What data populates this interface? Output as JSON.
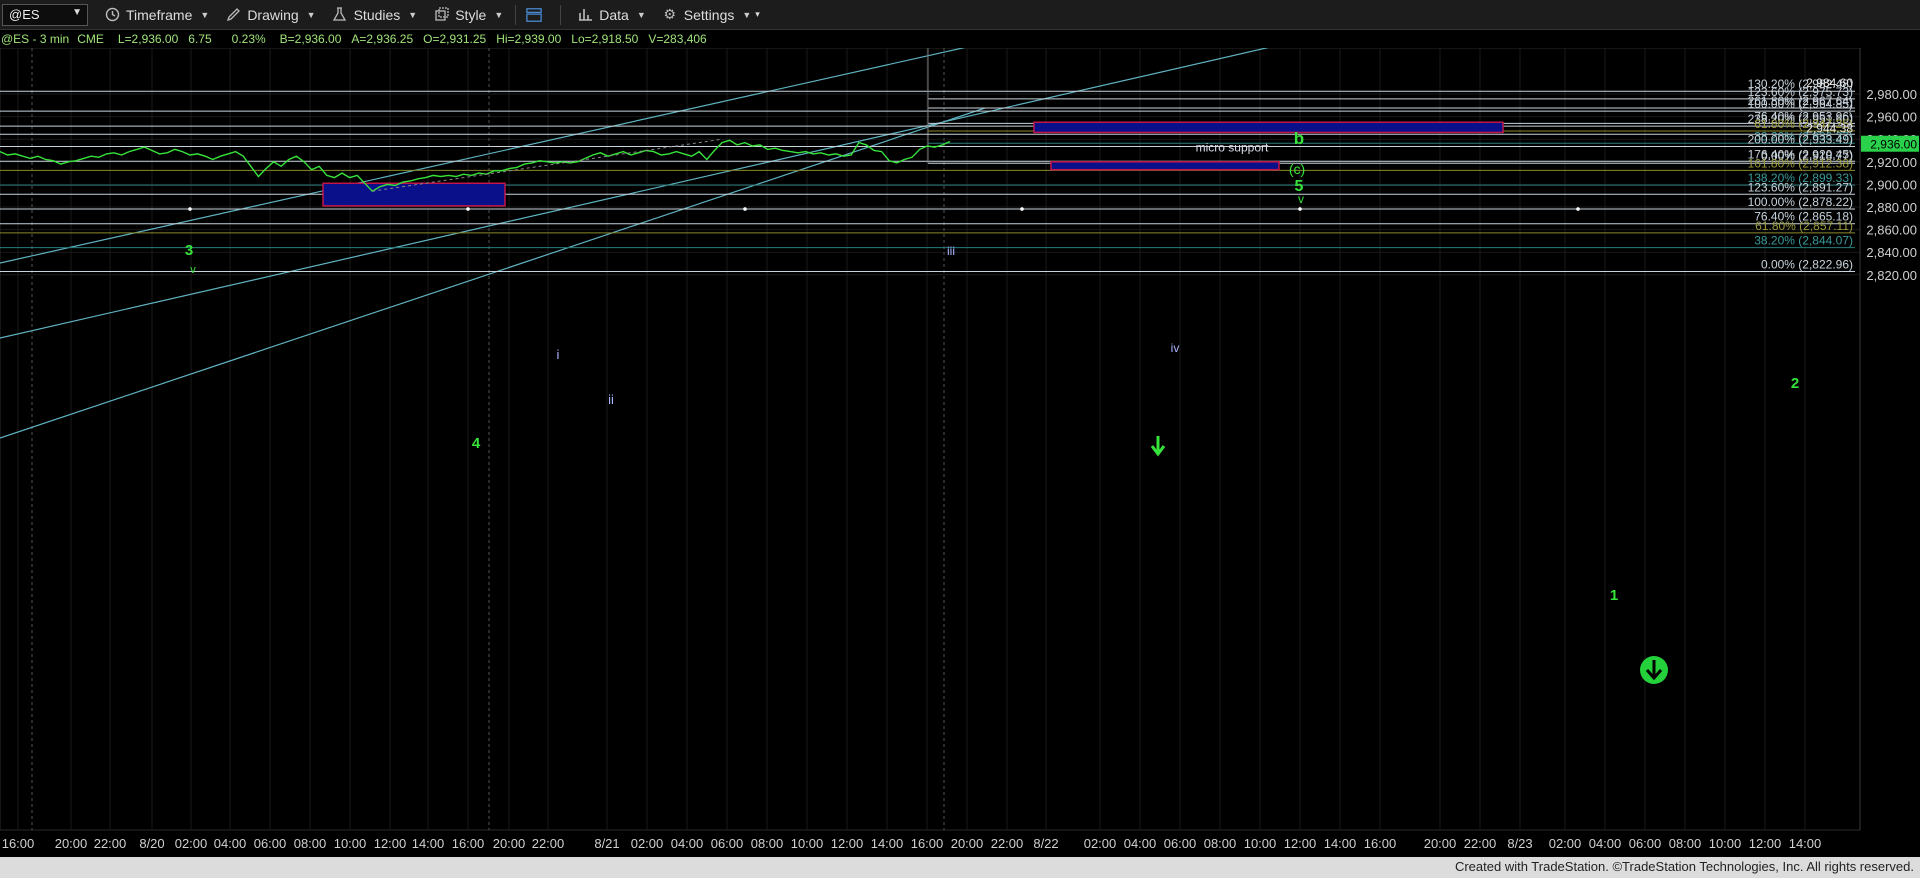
{
  "toolbar": {
    "symbol": "@ES",
    "timeframe": "Timeframe",
    "drawing": "Drawing",
    "studies": "Studies",
    "style": "Style",
    "data": "Data",
    "settings": "Settings"
  },
  "quote": {
    "symbol_interval": "@ES - 3 min",
    "exchange": "CME",
    "last": "L=2,936.00",
    "change": "6.75",
    "change_pct": "0.23%",
    "bid": "B=2,936.00",
    "ask": "A=2,936.25",
    "open": "O=2,931.25",
    "high": "Hi=2,939.00",
    "low": "Lo=2,918.50",
    "volume": "V=283,406"
  },
  "colors": {
    "price": "#36e33a",
    "fib": "#c8d3dc",
    "channel": "#5fb3c2",
    "box_fill": "#0a0f8a",
    "box_border": "#c2164a",
    "wave_green": "#36e33a",
    "wave_blue": "#aab6ff",
    "last_price_bg": "#2ad14a"
  },
  "footer": "Created with TradeStation. ©TradeStation Technologies, Inc. All rights reserved.",
  "chart_data": {
    "type": "line",
    "series": [
      {
        "values": [
          [
            0,
            2929
          ],
          [
            1,
            2926
          ],
          [
            2,
            2927
          ],
          [
            3,
            2925
          ],
          [
            4,
            2923
          ],
          [
            5,
            2925
          ],
          [
            6,
            2922
          ],
          [
            7,
            2921
          ],
          [
            8,
            2918
          ],
          [
            9,
            2920
          ],
          [
            10,
            2921
          ],
          [
            11,
            2923
          ],
          [
            12,
            2925
          ],
          [
            13,
            2924
          ],
          [
            14,
            2927
          ],
          [
            15,
            2928
          ],
          [
            16,
            2926
          ],
          [
            17,
            2929
          ],
          [
            18,
            2931
          ],
          [
            19,
            2933
          ],
          [
            20,
            2930
          ],
          [
            21,
            2927
          ],
          [
            22,
            2928
          ],
          [
            23,
            2931
          ],
          [
            24,
            2929
          ],
          [
            25,
            2926
          ],
          [
            26,
            2927
          ],
          [
            27,
            2925
          ],
          [
            28,
            2922
          ],
          [
            29,
            2925
          ],
          [
            30,
            2927
          ],
          [
            31,
            2929
          ],
          [
            32,
            2925
          ],
          [
            33,
            2916
          ],
          [
            34,
            2907
          ],
          [
            35,
            2914
          ],
          [
            36,
            2920
          ],
          [
            37,
            2916
          ],
          [
            38,
            2922
          ],
          [
            39,
            2925
          ],
          [
            40,
            2920
          ],
          [
            41,
            2913
          ],
          [
            42,
            2916
          ],
          [
            43,
            2908
          ],
          [
            44,
            2906
          ],
          [
            45,
            2910
          ],
          [
            46,
            2906
          ],
          [
            47,
            2908
          ],
          [
            48,
            2901
          ],
          [
            49,
            2894
          ],
          [
            50,
            2898
          ],
          [
            51,
            2900
          ],
          [
            52,
            2899
          ],
          [
            53,
            2902
          ],
          [
            54,
            2903
          ],
          [
            55,
            2905
          ],
          [
            56,
            2906
          ],
          [
            57,
            2908
          ],
          [
            58,
            2907
          ],
          [
            59,
            2908
          ],
          [
            60,
            2907
          ],
          [
            61,
            2909
          ],
          [
            62,
            2908
          ],
          [
            63,
            2910
          ],
          [
            64,
            2909
          ],
          [
            65,
            2912
          ],
          [
            66,
            2912
          ],
          [
            67,
            2914
          ],
          [
            68,
            2915
          ],
          [
            69,
            2918
          ],
          [
            70,
            2919
          ],
          [
            71,
            2921
          ],
          [
            72,
            2920
          ],
          [
            73,
            2919
          ],
          [
            74,
            2920
          ],
          [
            75,
            2919
          ],
          [
            76,
            2920
          ],
          [
            77,
            2923
          ],
          [
            78,
            2926
          ],
          [
            79,
            2928
          ],
          [
            80,
            2925
          ],
          [
            81,
            2927
          ],
          [
            82,
            2929
          ],
          [
            83,
            2926
          ],
          [
            84,
            2928
          ],
          [
            85,
            2930
          ],
          [
            86,
            2929
          ],
          [
            87,
            2926
          ],
          [
            88,
            2927
          ],
          [
            89,
            2929
          ],
          [
            90,
            2927
          ],
          [
            91,
            2925
          ],
          [
            92,
            2929
          ],
          [
            93,
            2922
          ],
          [
            94,
            2930
          ],
          [
            95,
            2937
          ],
          [
            96,
            2939
          ],
          [
            97,
            2935
          ],
          [
            98,
            2937
          ],
          [
            99,
            2934
          ],
          [
            100,
            2935
          ],
          [
            101,
            2931
          ],
          [
            102,
            2932
          ],
          [
            103,
            2930
          ],
          [
            104,
            2929
          ],
          [
            105,
            2928
          ],
          [
            106,
            2929
          ],
          [
            107,
            2927
          ],
          [
            108,
            2928
          ],
          [
            109,
            2926
          ],
          [
            110,
            2927
          ],
          [
            111,
            2925
          ],
          [
            112,
            2926
          ],
          [
            113,
            2937
          ],
          [
            114,
            2935
          ],
          [
            115,
            2930
          ],
          [
            116,
            2929
          ],
          [
            117,
            2921
          ],
          [
            118,
            2919
          ],
          [
            119,
            2922
          ],
          [
            120,
            2924
          ],
          [
            121,
            2931
          ],
          [
            122,
            2934
          ],
          [
            123,
            2933
          ],
          [
            124,
            2935
          ],
          [
            125,
            2938
          ]
        ]
      }
    ],
    "x_tick_labels": [
      "16:00",
      "20:00",
      "22:00",
      "8/20",
      "02:00",
      "04:00",
      "06:00",
      "08:00",
      "10:00",
      "12:00",
      "14:00",
      "16:00",
      "20:00",
      "22:00",
      "8/21",
      "02:00",
      "04:00",
      "06:00",
      "08:00",
      "10:00",
      "12:00",
      "14:00",
      "16:00",
      "20:00",
      "22:00",
      "8/22",
      "02:00",
      "04:00",
      "06:00",
      "08:00",
      "10:00",
      "12:00",
      "14:00",
      "16:00",
      "20:00",
      "22:00",
      "8/23",
      "02:00",
      "04:00",
      "06:00",
      "08:00",
      "10:00",
      "12:00",
      "14:00"
    ],
    "y_tick_labels": [
      "2,980.00",
      "2,960.00",
      "2,940.00",
      "2,920.00",
      "2,900.00",
      "2,880.00",
      "2,860.00",
      "2,840.00",
      "2,820.00"
    ],
    "ylim": [
      2805,
      2998
    ],
    "last_price": "2,936.00",
    "fib_levels": [
      {
        "label": "130.20% (2,982.48)",
        "value": 2982.48
      },
      {
        "label": "123.60% (2,975.73)",
        "value": 2975.73
      },
      {
        "label": "261.80% (2,967.64)",
        "value": 2967.64
      },
      {
        "label": "100.00% (2,964.85)",
        "value": 2964.85
      },
      {
        "label": "238.20% (2,951.60)",
        "value": 2951.6
      },
      {
        "label": "76.40% (2,953.96)",
        "value": 2953.96
      },
      {
        "label": "61.80% (2,947.25)",
        "value": 2947.25
      },
      {
        "label": "38.20% (2,936.37)",
        "value": 2936.37
      },
      {
        "label": "200.00% (2,933.49)",
        "value": 2933.49
      },
      {
        "label": "176.40% (2,920.45)",
        "value": 2920.45
      },
      {
        "label": "0.00% (2,918.77)",
        "value": 2918.77
      },
      {
        "label": "161.80% (2,912.38)",
        "value": 2912.38
      },
      {
        "label": "138.20% (2,899.33)",
        "value": 2899.33
      },
      {
        "label": "123.60% (2,891.27)",
        "value": 2891.27
      },
      {
        "label": "100.00% (2,878.22)",
        "value": 2878.22
      },
      {
        "label": "76.40% (2,865.18)",
        "value": 2865.18
      },
      {
        "label": "61.80% (2,857.11)",
        "value": 2857.11
      },
      {
        "label": "38.20% (2,844.07)",
        "value": 2844.07
      },
      {
        "label": "0.00% (2,822.96)",
        "value": 2822.96
      }
    ],
    "price_labels": [
      "2,984.60",
      "2,944.38"
    ],
    "wave_labels": [
      "3",
      "v",
      "4",
      "i",
      "ii",
      "iii",
      "iv",
      "v",
      "5",
      "(c)",
      "b",
      "2",
      "1"
    ],
    "annotations": [
      "micro support"
    ]
  }
}
